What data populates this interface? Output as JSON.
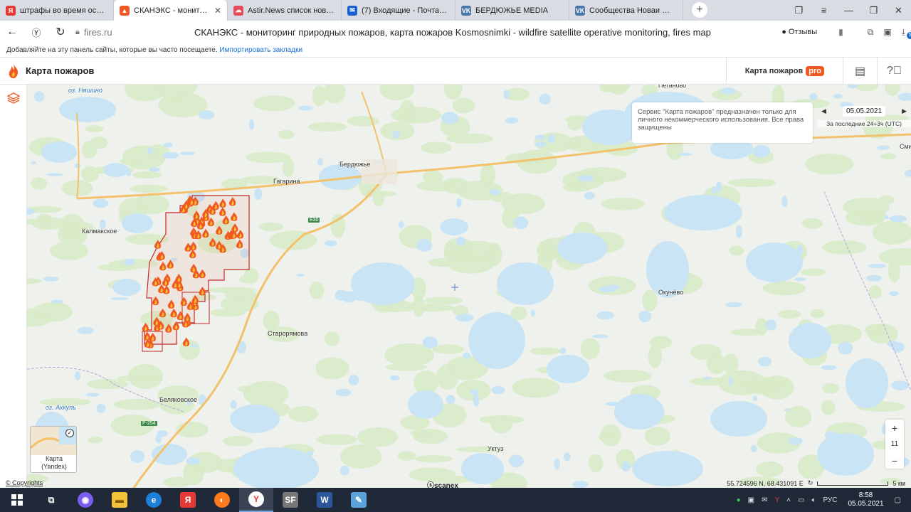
{
  "tabs": [
    {
      "title": "штрафы во время особог",
      "icon": "yandex-icon",
      "color": "#e53935",
      "glyph": "Я",
      "active": false
    },
    {
      "title": "СКАНЭКС - мониторин",
      "icon": "fire-icon",
      "color": "#ef5a24",
      "glyph": "▲",
      "active": true
    },
    {
      "title": "Astir.News список новостей",
      "icon": "cloud-icon",
      "color": "#e84b5a",
      "glyph": "☁",
      "active": false
    },
    {
      "title": "(7) Входящие - Почта Mail",
      "icon": "mail-icon",
      "color": "#1a5fd1",
      "glyph": "✉",
      "active": false
    },
    {
      "title": "БЕРДЮЖЬЕ MEDIA",
      "icon": "vk-icon",
      "color": "#4a76a8",
      "glyph": "VK",
      "active": false
    },
    {
      "title": "Сообщества Новаи Жизни",
      "icon": "vk-icon",
      "color": "#4a76a8",
      "glyph": "VK",
      "active": false
    }
  ],
  "address": {
    "url": "fires.ru",
    "page_title": "СКАНЭКС - мониторинг природных пожаров, карта пожаров Kosmosnimki - wildfire satellite operative monitoring, fires map",
    "reviews_label": "Отзывы",
    "downloads_badge": "5"
  },
  "bookmarks": {
    "text": "Добавляйте на эту панель сайты, которые вы часто посещаете.",
    "import_link": "Импортировать закладки"
  },
  "app": {
    "name": "Карта пожаров",
    "pro_label": "Карта пожаров",
    "pro_badge": "pro"
  },
  "map": {
    "labels": [
      {
        "text": "оз. Няшино",
        "water": true
      },
      {
        "text": "Бердюжье",
        "water": false
      },
      {
        "text": "Гагарина",
        "water": false
      },
      {
        "text": "Калмакское",
        "water": false
      },
      {
        "text": "Старорямова",
        "water": false
      },
      {
        "text": "Беляковское",
        "water": false
      },
      {
        "text": "оз. Аккуль",
        "water": true
      },
      {
        "text": "Окунёво",
        "water": false
      },
      {
        "text": "Уктуз",
        "water": false
      },
      {
        "text": "Пеганово",
        "water": false
      },
      {
        "text": "Сми",
        "water": false
      }
    ],
    "road_tags": [
      "E30",
      "P-254"
    ],
    "info_text": "Сервис \"Карта пожаров\" предназначен только для личного некоммерческого использования. Все права защищены",
    "date": "05.05.2021",
    "period": "За последние 24+3ч (UTC)",
    "zoom_level": "11",
    "zoom_in": "+",
    "zoom_out": "−",
    "minimap_label_1": "Карта",
    "minimap_label_2": "(Yandex)",
    "copyrights": "© Copyrights",
    "scanex": "scanex",
    "coordinates": "55.724596 N, 68.431091 E",
    "scale": "5 км"
  },
  "taskbar": {
    "time": "8:58",
    "date": "05.05.2021",
    "lang": "РУС"
  }
}
